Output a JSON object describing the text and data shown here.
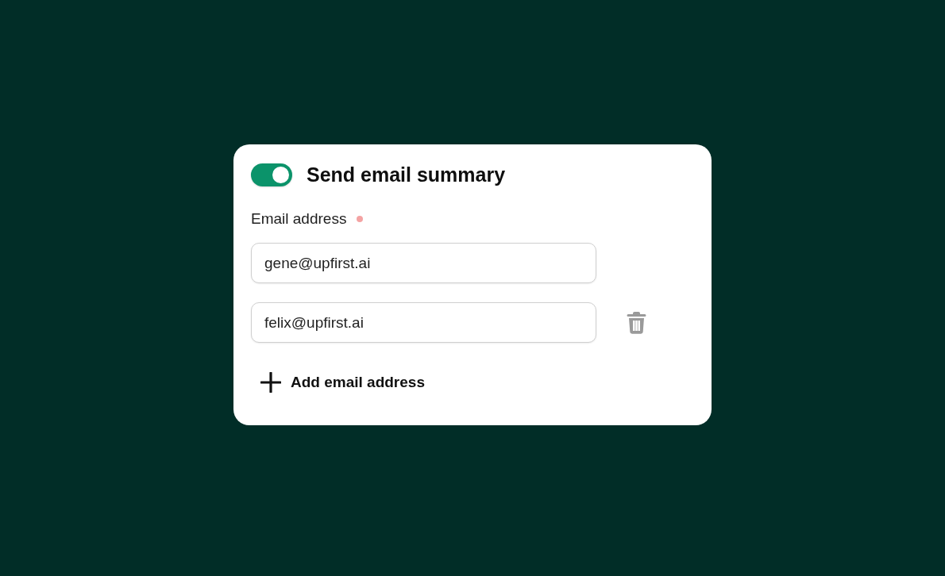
{
  "card": {
    "toggle": {
      "on": true
    },
    "title": "Send email summary",
    "field_label": "Email address",
    "required": true,
    "emails": [
      {
        "value": "gene@upfirst.ai",
        "removable": false
      },
      {
        "value": "felix@upfirst.ai",
        "removable": true
      }
    ],
    "add_button": "Add email address"
  }
}
